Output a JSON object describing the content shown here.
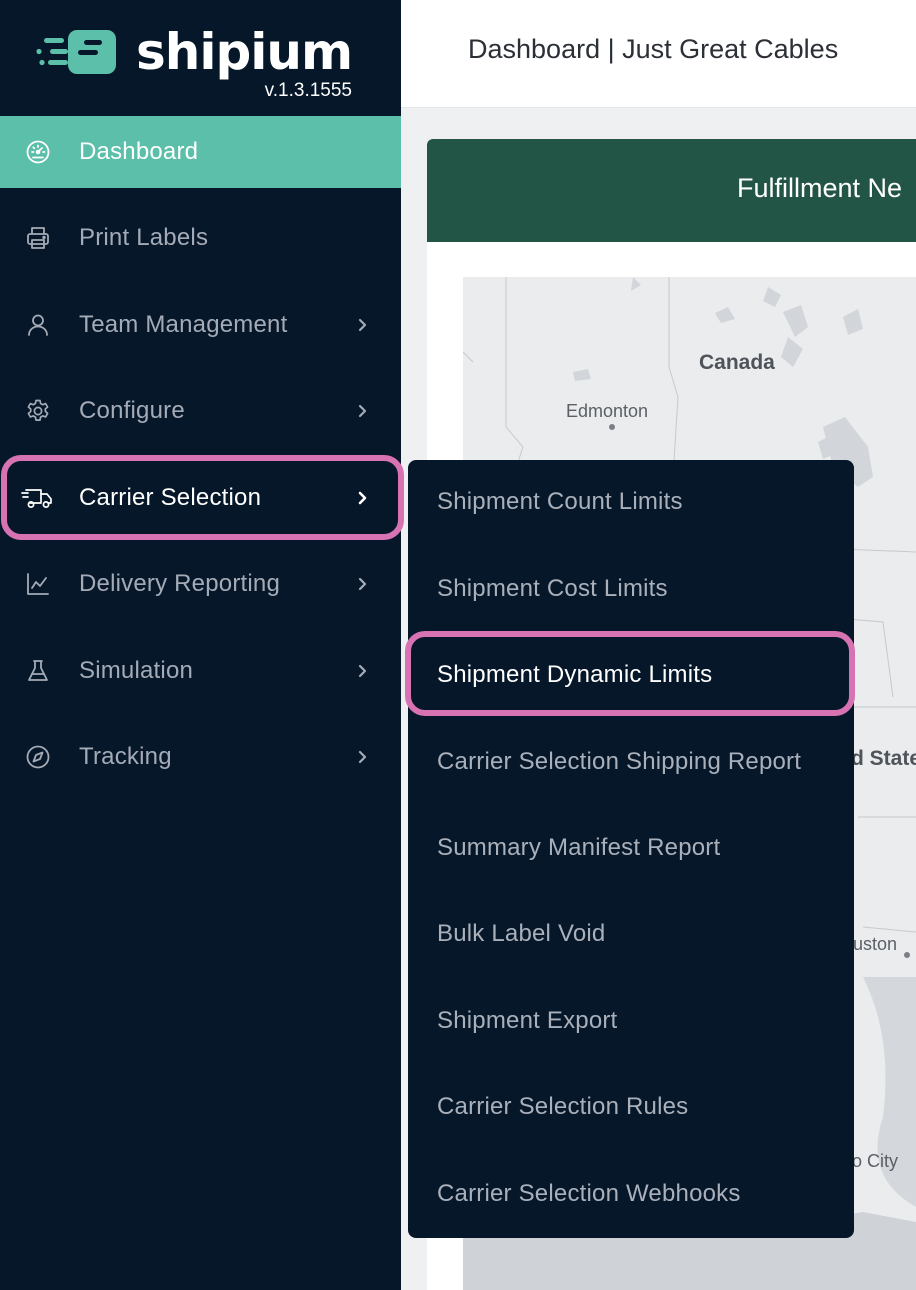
{
  "brand": {
    "name": "shipium",
    "version": "v.1.3.1555",
    "logo_color": "#5cbfa9"
  },
  "header": {
    "title": "Dashboard | Just Great Cables"
  },
  "sidebar": {
    "items": [
      {
        "label": "Dashboard",
        "icon": "speedometer-icon",
        "active": true,
        "has_chevron": false
      },
      {
        "label": "Print Labels",
        "icon": "printer-icon",
        "active": false,
        "has_chevron": false
      },
      {
        "label": "Team Management",
        "icon": "user-icon",
        "active": false,
        "has_chevron": true
      },
      {
        "label": "Configure",
        "icon": "gear-icon",
        "active": false,
        "has_chevron": true
      },
      {
        "label": "Carrier Selection",
        "icon": "truck-icon",
        "active": false,
        "open": true,
        "has_chevron": true
      },
      {
        "label": "Delivery Reporting",
        "icon": "line-chart-icon",
        "active": false,
        "has_chevron": true
      },
      {
        "label": "Simulation",
        "icon": "flask-icon",
        "active": false,
        "has_chevron": true
      },
      {
        "label": "Tracking",
        "icon": "compass-icon",
        "active": false,
        "has_chevron": true
      }
    ]
  },
  "submenu": {
    "items": [
      {
        "label": "Shipment Count Limits"
      },
      {
        "label": "Shipment Cost Limits"
      },
      {
        "label": "Shipment Dynamic Limits",
        "highlighted": true
      },
      {
        "label": "Carrier Selection Shipping Report"
      },
      {
        "label": "Summary Manifest Report"
      },
      {
        "label": "Bulk Label Void"
      },
      {
        "label": "Shipment Export"
      },
      {
        "label": "Carrier Selection Rules"
      },
      {
        "label": "Carrier Selection Webhooks"
      }
    ]
  },
  "main": {
    "card_title": "Fulfillment Ne",
    "map_labels": {
      "canada": "Canada",
      "edmonton": "Edmonton",
      "united_states": "d State",
      "houston": "uston",
      "mexico_city": "o City"
    }
  },
  "colors": {
    "sidebar_bg": "#06172a",
    "active_bg": "#5cbfa9",
    "highlight_border": "#d873b3",
    "card_header_bg": "#225545"
  }
}
